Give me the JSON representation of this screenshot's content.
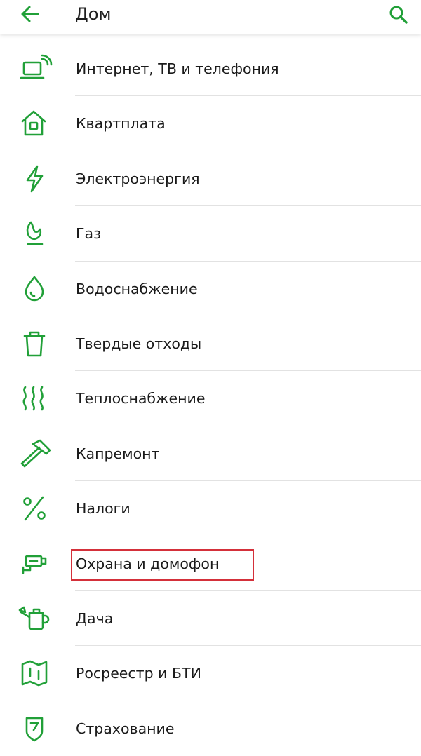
{
  "header": {
    "title": "Дом",
    "back_icon": "arrow-left-icon",
    "search_icon": "search-icon"
  },
  "colors": {
    "accent": "#21a038",
    "highlight": "#d4303a",
    "divider": "#e2e2e2"
  },
  "items": [
    {
      "label": "Интернет, ТВ и телефония",
      "icon": "laptop-wifi-icon"
    },
    {
      "label": "Квартплата",
      "icon": "house-icon"
    },
    {
      "label": "Электроэнергия",
      "icon": "lightning-icon"
    },
    {
      "label": "Газ",
      "icon": "gas-flame-icon"
    },
    {
      "label": "Водоснабжение",
      "icon": "water-drop-icon"
    },
    {
      "label": "Твердые отходы",
      "icon": "trash-bin-icon"
    },
    {
      "label": "Теплоснабжение",
      "icon": "heat-waves-icon"
    },
    {
      "label": "Капремонт",
      "icon": "hammer-icon"
    },
    {
      "label": "Налоги",
      "icon": "percent-icon"
    },
    {
      "label": "Охрана и домофон",
      "icon": "security-camera-icon"
    },
    {
      "label": "Дача",
      "icon": "watering-can-icon"
    },
    {
      "label": "Росреестр и БТИ",
      "icon": "map-icon"
    },
    {
      "label": "Страхование",
      "icon": "shield-icon"
    }
  ]
}
